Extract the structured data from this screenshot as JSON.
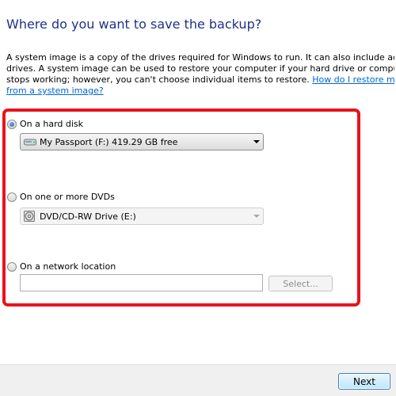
{
  "heading": "Where do you want to save the backup?",
  "description": {
    "line1": "A system image is a copy of the drives required for Windows to run. It can also include additional",
    "line2": "drives. A system image can be used to restore your computer if your hard drive or computer ever",
    "line3_text": "stops working; however, you can't choose individual items to restore. ",
    "link_part1": "How do I restore my computer",
    "link_part2": "from a system image?"
  },
  "options": {
    "hard_disk": {
      "label": "On a hard disk",
      "selected": true,
      "drive": "My Passport (F:)  419.29 GB free"
    },
    "dvd": {
      "label": "On one or more DVDs",
      "selected": false,
      "drive": "DVD/CD-RW Drive (E:)"
    },
    "network": {
      "label": "On a network location",
      "selected": false,
      "path_value": "",
      "select_button": "Select..."
    }
  },
  "footer": {
    "next_label": "Next"
  },
  "colors": {
    "heading": "#1e3287",
    "link": "#0066cc",
    "highlight": "#e8131c"
  }
}
